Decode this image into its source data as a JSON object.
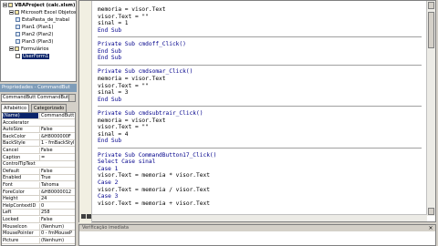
{
  "project": {
    "nodes": [
      {
        "label": "VBAProject (calc.xlsm)",
        "kind": "root",
        "depth": 0
      },
      {
        "label": "Microsoft Excel Objetos",
        "kind": "folder",
        "depth": 1
      },
      {
        "label": "EstaPasta_de_trabal",
        "kind": "sheet",
        "depth": 2
      },
      {
        "label": "Plan1 (Plan1)",
        "kind": "sheet",
        "depth": 2
      },
      {
        "label": "Plan2 (Plan2)",
        "kind": "sheet",
        "depth": 2
      },
      {
        "label": "Plan3 (Plan3)",
        "kind": "sheet",
        "depth": 2
      },
      {
        "label": "Formulários",
        "kind": "folder",
        "depth": 1
      },
      {
        "label": "UserForm1",
        "kind": "form",
        "depth": 2
      }
    ]
  },
  "properties": {
    "header": "Propriedades - CommandBut",
    "object_combo": "CommandButt CommandButt",
    "tabs": [
      "Alfabético",
      "Categorizado"
    ],
    "rows": [
      {
        "name": "(Name)",
        "value": "CommandButt"
      },
      {
        "name": "Accelerator",
        "value": ""
      },
      {
        "name": "AutoSize",
        "value": "False"
      },
      {
        "name": "BackColor",
        "value": "&H8000000F"
      },
      {
        "name": "BackStyle",
        "value": "1 - fmBackStyl"
      },
      {
        "name": "Cancel",
        "value": "False"
      },
      {
        "name": "Caption",
        "value": "="
      },
      {
        "name": "ControlTipText",
        "value": ""
      },
      {
        "name": "Default",
        "value": "False"
      },
      {
        "name": "Enabled",
        "value": "True"
      },
      {
        "name": "Font",
        "value": "Tahoma"
      },
      {
        "name": "ForeColor",
        "value": "&H80000012"
      },
      {
        "name": "Height",
        "value": "24"
      },
      {
        "name": "HelpContextID",
        "value": "0"
      },
      {
        "name": "Left",
        "value": "258"
      },
      {
        "name": "Locked",
        "value": "False"
      },
      {
        "name": "MouseIcon",
        "value": "(Nenhum)"
      },
      {
        "name": "MousePointer",
        "value": "0 - fmMouseP"
      },
      {
        "name": "Picture",
        "value": "(Nenhum)"
      }
    ]
  },
  "code": {
    "lines": [
      {
        "text": "memoria = visor.Text",
        "type": "code"
      },
      {
        "text": "visor.Text = \"\"",
        "type": "code"
      },
      {
        "text": "sinal = 1",
        "type": "code"
      },
      {
        "text": "End Sub",
        "type": "kw"
      },
      {
        "text": "",
        "type": "sep"
      },
      {
        "text": "Private Sub cmdoff_Click()",
        "type": "kw"
      },
      {
        "text": "End Sub",
        "type": "kw"
      },
      {
        "text": "End Sub",
        "type": "kw"
      },
      {
        "text": "",
        "type": "sep"
      },
      {
        "text": "Private Sub cmdsomar_Click()",
        "type": "kw"
      },
      {
        "text": "memoria = visor.Text",
        "type": "code"
      },
      {
        "text": "visor.Text = \"\"",
        "type": "code"
      },
      {
        "text": "sinal = 3",
        "type": "code"
      },
      {
        "text": "End Sub",
        "type": "kw"
      },
      {
        "text": "",
        "type": "sep"
      },
      {
        "text": "Private Sub cmdsubtrair_Click()",
        "type": "kw"
      },
      {
        "text": "memoria = visor.Text",
        "type": "code"
      },
      {
        "text": "visor.Text = \"\"",
        "type": "code"
      },
      {
        "text": "sinal = 4",
        "type": "code"
      },
      {
        "text": "End Sub",
        "type": "kw"
      },
      {
        "text": "",
        "type": "sep"
      },
      {
        "text": "Private Sub CommandButton17_Click()",
        "type": "kw"
      },
      {
        "text": "Select Case sinal",
        "type": "kw"
      },
      {
        "text": "Case 1",
        "type": "kw"
      },
      {
        "text": "visor.Text = memoria * visor.Text",
        "type": "code"
      },
      {
        "text": "Case 2",
        "type": "kw"
      },
      {
        "text": "visor.Text = memoria / visor.Text",
        "type": "code"
      },
      {
        "text": "Case 3",
        "type": "kw"
      },
      {
        "text": "visor.Text = memoria + visor.Text",
        "type": "code"
      }
    ]
  },
  "immediate": {
    "title": "Verificação imediata",
    "close_glyph": "×"
  }
}
